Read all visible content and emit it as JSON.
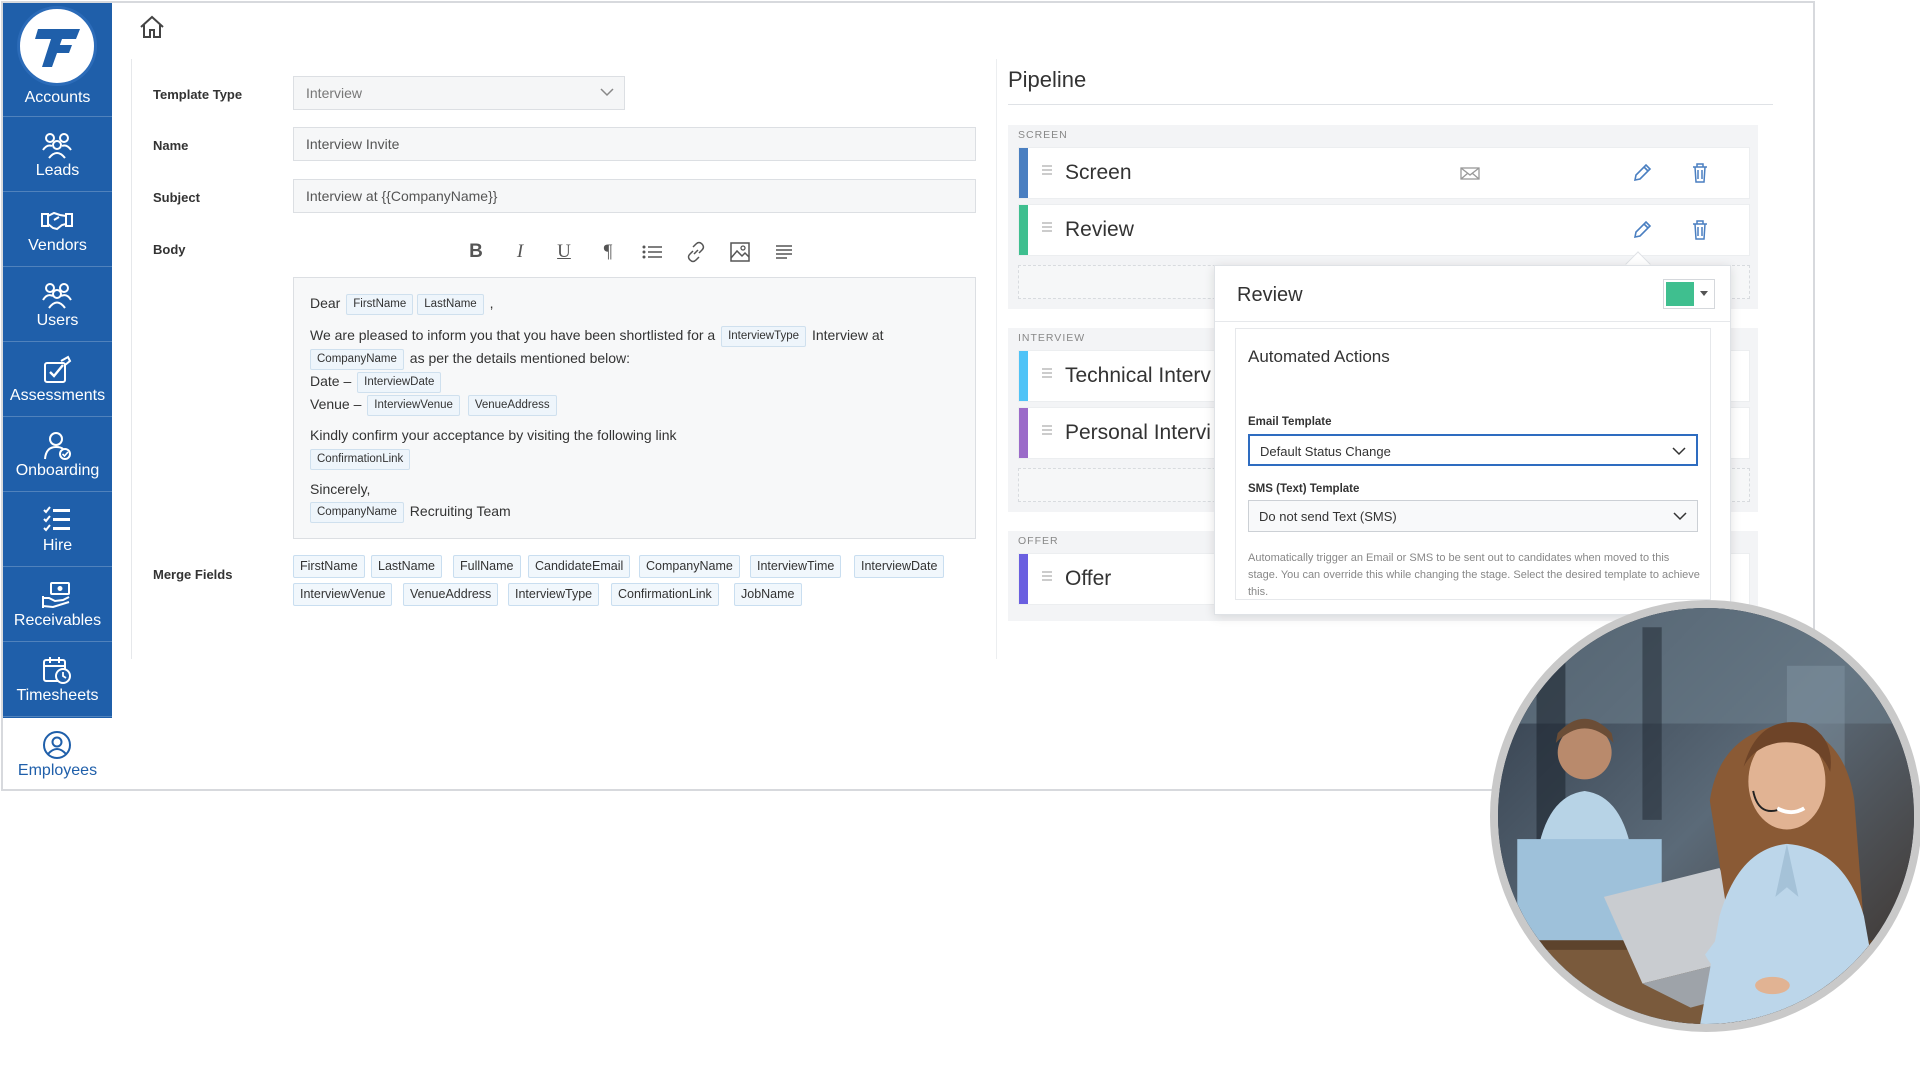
{
  "sidebar": {
    "brand": "Accounts",
    "items": [
      {
        "label": "Leads",
        "icon": "leads-icon"
      },
      {
        "label": "Vendors",
        "icon": "handshake-icon"
      },
      {
        "label": "Users",
        "icon": "users-icon"
      },
      {
        "label": "Assessments",
        "icon": "assessment-icon"
      },
      {
        "label": "Onboarding",
        "icon": "onboarding-icon"
      },
      {
        "label": "Hire",
        "icon": "list-icon"
      },
      {
        "label": "Receivables",
        "icon": "money-hand-icon"
      },
      {
        "label": "Timesheets",
        "icon": "calendar-clock-icon"
      },
      {
        "label": "Employees",
        "icon": "employee-icon"
      }
    ],
    "active_item": "Employees",
    "colors": {
      "background": "#1f5faa",
      "active_background": "#ffffff"
    }
  },
  "form": {
    "template_type": {
      "label": "Template Type",
      "value": "Interview"
    },
    "name": {
      "label": "Name",
      "value": "Interview Invite"
    },
    "subject": {
      "label": "Subject",
      "value": "Interview at {{CompanyName}}"
    },
    "body": {
      "label": "Body",
      "toolbar": [
        "B",
        "I",
        "U",
        "¶",
        "bulleted-list",
        "link",
        "image",
        "align"
      ],
      "text": {
        "dear": "Dear",
        "comma": ",",
        "line2_a": "We are pleased to inform you that you have been shortlisted for a",
        "line2_b": "Interview at",
        "line3": "as per the details mentioned below:",
        "date": "Date –",
        "venue": "Venue –",
        "confirm": "Kindly confirm your acceptance by visiting the following link",
        "sincerely": "Sincerely,",
        "team": "Recruiting Team"
      },
      "chips": {
        "first_name": "FirstName",
        "last_name": "LastName",
        "interview_type": "InterviewType",
        "company_name": "CompanyName",
        "interview_date": "InterviewDate",
        "interview_venue": "InterviewVenue",
        "venue_address": "VenueAddress",
        "confirmation_link": "ConfirmationLink"
      }
    },
    "merge_fields": {
      "label": "Merge Fields",
      "items": [
        "FirstName",
        "LastName",
        "FullName",
        "CandidateEmail",
        "CompanyName",
        "InterviewTime",
        "InterviewDate",
        "InterviewVenue",
        "VenueAddress",
        "InterviewType",
        "ConfirmationLink",
        "JobName"
      ]
    }
  },
  "pipeline": {
    "title": "Pipeline",
    "groups": [
      {
        "label": "SCREEN",
        "stages": [
          {
            "name": "Screen",
            "color": "#4a7fc1"
          },
          {
            "name": "Review",
            "color": "#3fbf8f"
          }
        ]
      },
      {
        "label": "INTERVIEW",
        "stages": [
          {
            "name": "Technical Interv",
            "color": "#4fc3f7"
          },
          {
            "name": "Personal Intervi",
            "color": "#9b6bc9"
          }
        ]
      },
      {
        "label": "OFFER",
        "stages": [
          {
            "name": "Offer",
            "color": "#6a5fe0"
          }
        ]
      }
    ]
  },
  "popover": {
    "title": "Review",
    "stage_color": "#3fbf8f",
    "section_title": "Automated Actions",
    "email_template": {
      "label": "Email Template",
      "value": "Default Status Change"
    },
    "sms_template": {
      "label": "SMS (Text) Template",
      "value": "Do not send Text (SMS)"
    },
    "help_text": "Automatically trigger an Email or SMS to be sent out to candidates when moved to this stage. You can override this while changing the stage. Select the desired template to achieve this."
  }
}
